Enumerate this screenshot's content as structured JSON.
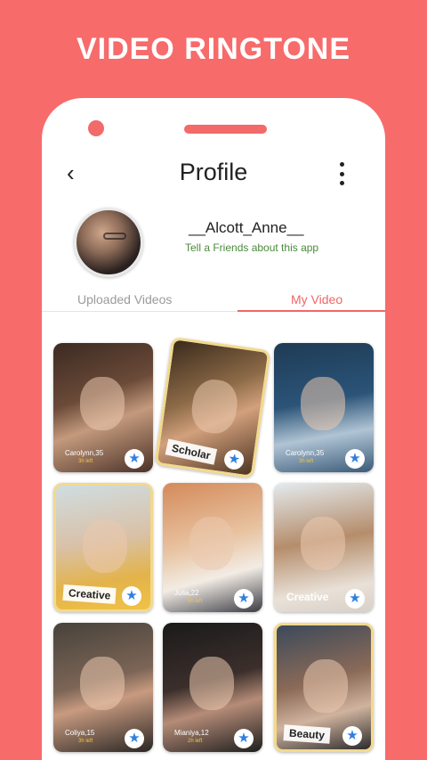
{
  "promo": {
    "title": "VIDEO RINGTONE"
  },
  "header": {
    "back_icon": "‹",
    "title": "Profile",
    "more_icon": "more-vertical"
  },
  "profile": {
    "username": "__Alcott_Anne__",
    "share_text": "Tell a Friends about this app"
  },
  "tabs": [
    {
      "label": "Uploaded Videos",
      "active": false
    },
    {
      "label": "My Video",
      "active": true
    }
  ],
  "videos": [
    {
      "name": "Carolynn,35",
      "time": "3h left",
      "tag": ""
    },
    {
      "name": "",
      "time": "",
      "tag": "Scholar"
    },
    {
      "name": "Carolynn,35",
      "time": "3h left",
      "tag": ""
    },
    {
      "name": "",
      "time": "",
      "tag": "Creative"
    },
    {
      "name": "Julia,22",
      "time": "6h left",
      "tag": ""
    },
    {
      "name": "",
      "time": "",
      "tag": "Creative"
    },
    {
      "name": "Coliya,15",
      "time": "3h left",
      "tag": ""
    },
    {
      "name": "Mianiya,12",
      "time": "2h left",
      "tag": ""
    },
    {
      "name": "",
      "time": "",
      "tag": "Beauty"
    }
  ],
  "star_icon": "★",
  "colors": {
    "background": "#f76b6b",
    "accent": "#f06666",
    "star": "#2f7fe0",
    "link": "#4a8a3c"
  }
}
